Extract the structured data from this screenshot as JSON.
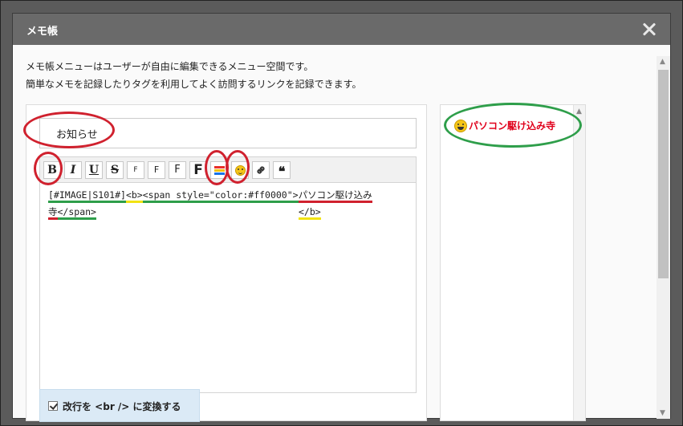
{
  "dialog": {
    "title": "メモ帳",
    "description_line1": "メモ帳メニューはユーザーが自由に編集できるメニュー空間です。",
    "description_line2": "簡単なメモを記録したりタグを利用してよく訪問するリンクを記録できます。"
  },
  "editor": {
    "title_value": "お知らせ",
    "toolbar": {
      "bold": "B",
      "italic": "I",
      "underline": "U",
      "strike": "S",
      "font_small": "F",
      "font_medium": "F",
      "font_large": "F",
      "font_xlarge": "F",
      "quote": "❝"
    },
    "content": {
      "image_tag": "[#IMAGE|S101#]",
      "b_open": "<b>",
      "span_open": "<span style=\"color:#ff0000\">",
      "text_part1": "パソコン駆け込み",
      "text_part2": "寺",
      "span_close": "</span>",
      "b_close": "</b>"
    },
    "br_option_label": "改行を <br /> に変換する"
  },
  "preview": {
    "text": "パソコン駆け込み寺",
    "color": "#e0001b"
  },
  "icons": {
    "close": "close-icon",
    "color": "color-palette-icon",
    "emoji": "emoji-icon",
    "link": "link-icon",
    "quote": "quote-icon"
  },
  "colors": {
    "titlebar": "#6a6a6a",
    "annotation_red": "#d0212e",
    "annotation_green": "#2e9e4a",
    "annotation_yellow": "#f2e313"
  }
}
